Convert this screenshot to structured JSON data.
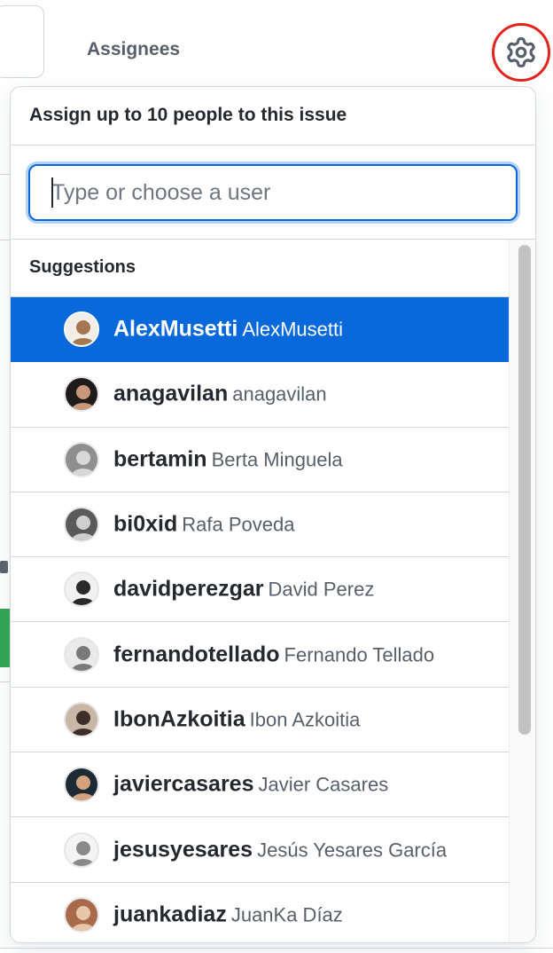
{
  "sidebar": {
    "title": "Assignees",
    "gear_icon": "gear-icon",
    "highlight_color": "#e2241c"
  },
  "popover": {
    "title": "Assign up to 10 people to this issue",
    "search": {
      "value": "",
      "placeholder": "Type or choose a user"
    },
    "suggestions_label": "Suggestions",
    "accent_color": "#0969da",
    "users": [
      {
        "login": "AlexMusetti",
        "name": "AlexMusetti",
        "selected": true,
        "avatar": {
          "bg": "#f2ede8",
          "fg": "#a5764f"
        }
      },
      {
        "login": "anagavilan",
        "name": "anagavilan",
        "selected": false,
        "avatar": {
          "bg": "#1f1b1a",
          "fg": "#c9987a"
        }
      },
      {
        "login": "bertamin",
        "name": "Berta Minguela",
        "selected": false,
        "avatar": {
          "bg": "#8e8e8e",
          "fg": "#d8d8d8"
        }
      },
      {
        "login": "bi0xid",
        "name": "Rafa Poveda",
        "selected": false,
        "avatar": {
          "bg": "#5a5a5a",
          "fg": "#cfcfcf"
        }
      },
      {
        "login": "davidperezgar",
        "name": "David Perez",
        "selected": false,
        "avatar": {
          "bg": "#f1f1f1",
          "fg": "#2a2a2a"
        }
      },
      {
        "login": "fernandotellado",
        "name": "Fernando Tellado",
        "selected": false,
        "avatar": {
          "bg": "#eaeaea",
          "fg": "#7a7a7a"
        }
      },
      {
        "login": "IbonAzkoitia",
        "name": "Ibon Azkoitia",
        "selected": false,
        "avatar": {
          "bg": "#c9b7a5",
          "fg": "#3b2f28"
        }
      },
      {
        "login": "javiercasares",
        "name": "Javier Casares",
        "selected": false,
        "avatar": {
          "bg": "#1e2a33",
          "fg": "#d4a37e"
        }
      },
      {
        "login": "jesusyesares",
        "name": "Jesús Yesares García",
        "selected": false,
        "avatar": {
          "bg": "#f4f4f4",
          "fg": "#8a8a8a"
        }
      },
      {
        "login": "juankadiaz",
        "name": "JuanKa Díaz",
        "selected": false,
        "avatar": {
          "bg": "#a86a4a",
          "fg": "#e7c7a8"
        }
      }
    ]
  }
}
